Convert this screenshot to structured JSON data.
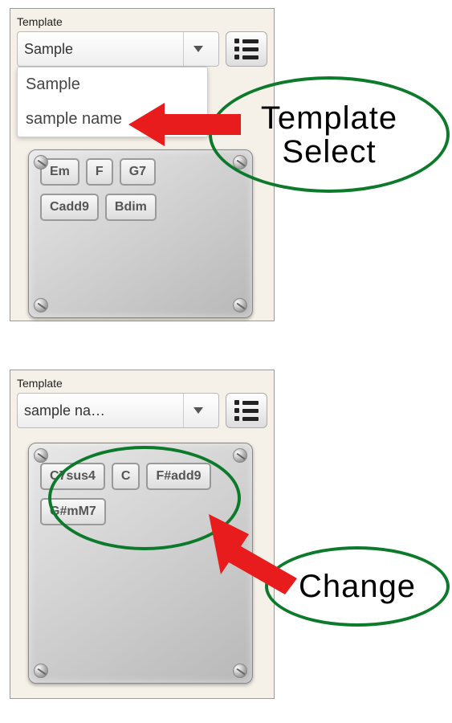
{
  "panel1": {
    "label": "Template",
    "selected": "Sample",
    "dropdown": [
      "Sample",
      "sample name"
    ],
    "chords_row1": [
      "Em",
      "F",
      "G7"
    ],
    "chords_row2": [
      "Cadd9",
      "Bdim"
    ]
  },
  "panel2": {
    "label": "Template",
    "selected": "sample na…",
    "chords_row1": [
      "C7sus4",
      "C",
      "F#add9"
    ],
    "chords_row2": [
      "G#mM7"
    ]
  },
  "callouts": {
    "select_line1": "Template",
    "select_line2": "Select",
    "change": "Change"
  }
}
